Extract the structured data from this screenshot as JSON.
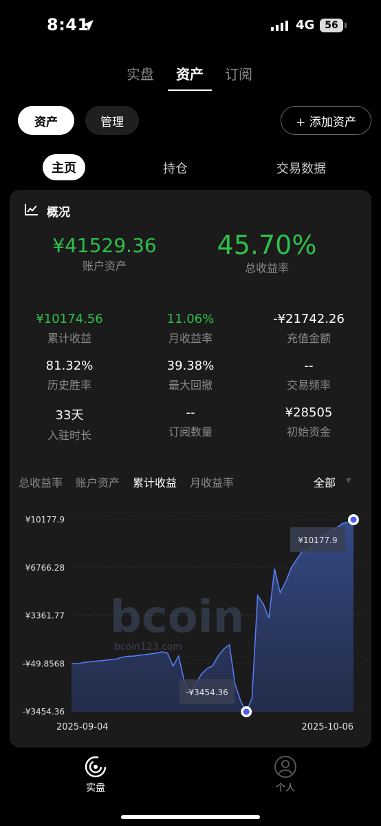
{
  "status": {
    "time": "8:41",
    "network": "4G",
    "battery": "56"
  },
  "top_tabs": [
    "实盘",
    "资产",
    "订阅"
  ],
  "pills": {
    "assets": "资产",
    "manage": "管理",
    "add": "+ 添加资产"
  },
  "sub_tabs": [
    "主页",
    "持仓",
    "交易数据"
  ],
  "overview": {
    "title": "概况",
    "account_assets": {
      "value": "¥41529.36",
      "label": "账户资产"
    },
    "total_return": {
      "value": "45.70%",
      "label": "总收益率"
    },
    "stats": [
      {
        "value": "¥10174.56",
        "label": "累计收益",
        "color": "#2fbf4a"
      },
      {
        "value": "11.06%",
        "label": "月收益率",
        "color": "#2fbf4a"
      },
      {
        "value": "-¥21742.26",
        "label": "充值金额",
        "color": "#ffffff"
      },
      {
        "value": "81.32%",
        "label": "历史胜率",
        "color": "#ffffff"
      },
      {
        "value": "39.38%",
        "label": "最大回撤",
        "color": "#ffffff"
      },
      {
        "value": "--",
        "label": "交易频率",
        "color": "#ffffff"
      },
      {
        "value": "33天",
        "label": "入驻时长",
        "color": "#ffffff"
      },
      {
        "value": "--",
        "label": "订阅数量",
        "color": "#ffffff"
      },
      {
        "value": "¥28505",
        "label": "初始资金",
        "color": "#ffffff"
      }
    ]
  },
  "chart_tabs": [
    "总收益率",
    "账户资产",
    "累计收益",
    "月收益率"
  ],
  "chart_active": "累计收益",
  "chart_range": "全部",
  "chart_data": {
    "type": "area",
    "y_ticks": [
      "¥10177.9",
      "¥6766.28",
      "¥3361.77",
      "-¥49.8568",
      "-¥3454.36"
    ],
    "ylim": [
      -3454.36,
      10177.9
    ],
    "x_ticks": [
      "2025-09-04",
      "2025-10-06"
    ],
    "max_label": "¥10177.9",
    "min_label": "-¥3454.36",
    "series": [
      {
        "values": [
          -49.86,
          -50,
          30,
          80,
          120,
          160,
          200,
          250,
          300,
          420,
          480,
          500,
          550,
          600,
          650,
          700,
          800,
          720,
          -200,
          500,
          -1300,
          -2200,
          -1500,
          -800,
          -400,
          -200,
          500,
          1000,
          1300,
          -1500,
          -2700,
          -3454.36,
          -2500,
          4800,
          4200,
          3200,
          6700,
          5000,
          5800,
          6800,
          7400,
          8000,
          7900,
          8600,
          8900,
          9100,
          9400,
          9600,
          9900,
          10000,
          10177.9
        ]
      }
    ]
  },
  "watermark": {
    "text": "bcoin123.com"
  },
  "bottom_nav": [
    "实盘",
    "个人"
  ]
}
